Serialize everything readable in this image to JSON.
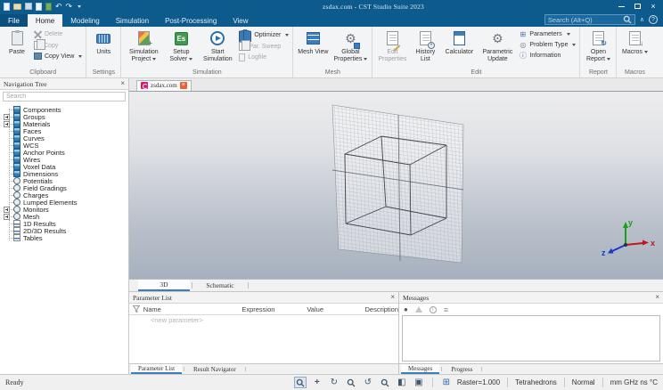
{
  "window": {
    "title": "zsdax.com - CST Studio Suite 2023"
  },
  "icons": {
    "close": "×",
    "gear": "⚙",
    "info": "ⓘ",
    "target": "◎",
    "grid_box": "⊞",
    "undo": "↶",
    "redo": "↷",
    "rotate_cw": "↻",
    "rotate_ccw": "↺",
    "split_view": "◧",
    "cube_solid": "▣",
    "menu": "≡",
    "error_dot": "●",
    "caret_up": "∧",
    "help": "?",
    "plus": "+",
    "arrow_down": "↓",
    "clock": "•",
    "solver_letters": "Es"
  },
  "ribbon": {
    "tabs": [
      "File",
      "Home",
      "Modeling",
      "Simulation",
      "Post-Processing",
      "View"
    ],
    "active_tab": "Home",
    "search_placeholder": "Search (Alt+Q)",
    "clipboard": {
      "label": "Clipboard",
      "paste": "Paste",
      "delete": "Delete",
      "copy": "Copy",
      "copy_view": "Copy View"
    },
    "settings": {
      "label": "Settings",
      "units": "Units"
    },
    "simulation": {
      "label": "Simulation",
      "simulation_project": "Simulation Project",
      "setup_solver": "Setup Solver",
      "start_simulation": "Start Simulation",
      "optimizer": "Optimizer",
      "par_sweep": "Par. Sweep",
      "logfile": "Logfile"
    },
    "mesh": {
      "label": "Mesh",
      "mesh_view": "Mesh View",
      "global_properties": "Global Properties"
    },
    "edit": {
      "label": "Edit",
      "edit_properties": "Edit Properties",
      "history_list": "History List",
      "calculator": "Calculator",
      "parametric_update": "Parametric Update",
      "parameters": "Parameters",
      "problem_type": "Problem Type",
      "information": "Information"
    },
    "report": {
      "label": "Report",
      "open_report": "Open Report"
    },
    "macros_group": {
      "label": "Macros",
      "macros": "Macros"
    }
  },
  "navigation_tree": {
    "title": "Navigation Tree",
    "search_placeholder": "Search",
    "items": [
      {
        "label": "Components",
        "icon": "cube",
        "expandable": false
      },
      {
        "label": "Groups",
        "icon": "cube",
        "expandable": true
      },
      {
        "label": "Materials",
        "icon": "cube",
        "expandable": true
      },
      {
        "label": "Faces",
        "icon": "cube",
        "expandable": false
      },
      {
        "label": "Curves",
        "icon": "cube",
        "expandable": false
      },
      {
        "label": "WCS",
        "icon": "cube",
        "expandable": false
      },
      {
        "label": "Anchor Points",
        "icon": "cube",
        "expandable": false
      },
      {
        "label": "Wires",
        "icon": "cube",
        "expandable": false
      },
      {
        "label": "Voxel Data",
        "icon": "cube",
        "expandable": false
      },
      {
        "label": "Dimensions",
        "icon": "cube",
        "expandable": false
      },
      {
        "label": "Potentials",
        "icon": "circle",
        "expandable": false
      },
      {
        "label": "Field Gradings",
        "icon": "circle",
        "expandable": false
      },
      {
        "label": "Charges",
        "icon": "circle",
        "expandable": false
      },
      {
        "label": "Lumped Elements",
        "icon": "circle",
        "expandable": false
      },
      {
        "label": "Monitors",
        "icon": "circle",
        "expandable": true
      },
      {
        "label": "Mesh",
        "icon": "circle",
        "expandable": true
      },
      {
        "label": "1D Results",
        "icon": "chart",
        "expandable": false
      },
      {
        "label": "2D/3D Results",
        "icon": "chart",
        "expandable": false
      },
      {
        "label": "Tables",
        "icon": "chart",
        "expandable": false
      }
    ]
  },
  "document": {
    "tab_title": "zsdax.com",
    "view_tabs": [
      "3D",
      "Schematic"
    ],
    "active_view_tab": "3D",
    "axes": {
      "x": "x",
      "y": "y",
      "z": "z"
    },
    "axis_colors": {
      "x": "#c01818",
      "y": "#18a018",
      "z": "#1838c8"
    }
  },
  "parameter_list": {
    "title": "Parameter List",
    "columns": [
      "Name",
      "Expression",
      "Value",
      "Description"
    ],
    "new_parameter_row": "<new parameter>",
    "tabs": [
      "Parameter List",
      "Result Navigator"
    ],
    "active_tab": "Parameter List"
  },
  "messages": {
    "title": "Messages",
    "tabs": [
      "Messages",
      "Progress"
    ],
    "active_tab": "Messages"
  },
  "status_bar": {
    "ready": "Ready",
    "raster": "Raster=1.000",
    "mesh_type": "Tetrahedrons",
    "view_mode": "Normal",
    "units": "mm GHz ns °C"
  }
}
